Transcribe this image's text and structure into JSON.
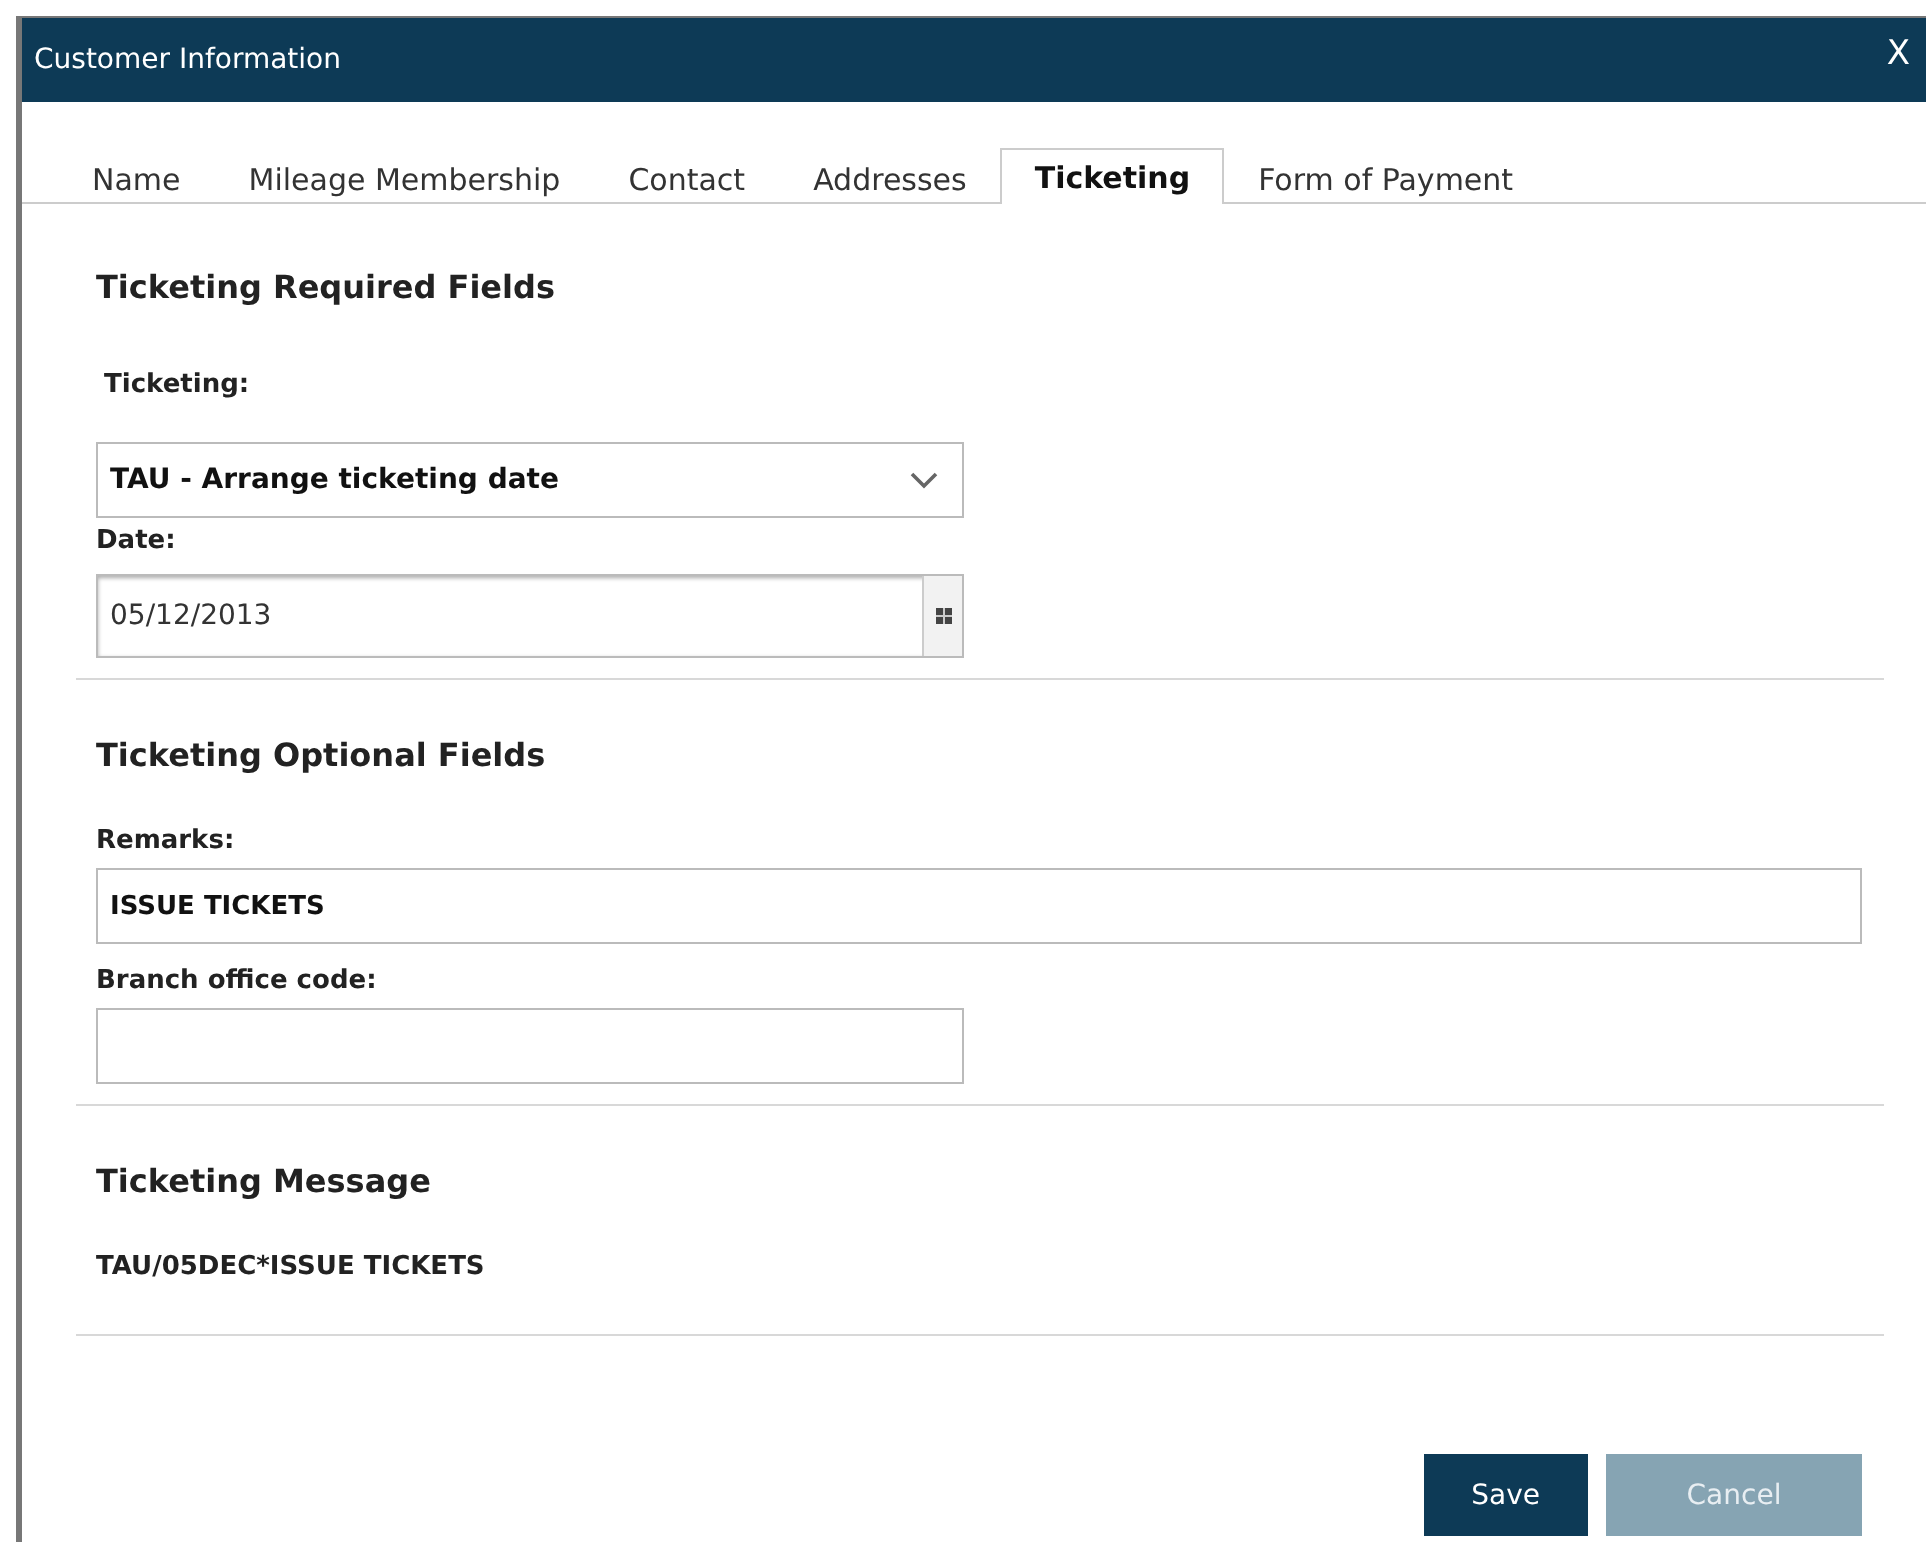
{
  "window": {
    "title": "Customer Information",
    "close": "X"
  },
  "tabs": [
    {
      "label": "Name",
      "selected": false
    },
    {
      "label": "Mileage Membership",
      "selected": false
    },
    {
      "label": "Contact",
      "selected": false
    },
    {
      "label": "Addresses",
      "selected": false
    },
    {
      "label": "Ticketing",
      "selected": true
    },
    {
      "label": "Form of Payment",
      "selected": false
    }
  ],
  "sections": [
    {
      "heading": "Ticketing Required Fields",
      "fields": [
        {
          "kind": "dropdown",
          "label": "Ticketing:",
          "value": "TAU - Arrange ticketing date"
        },
        {
          "kind": "date",
          "label": "Date:",
          "value": "05/12/2013"
        }
      ]
    },
    {
      "heading": "Ticketing Optional Fields",
      "fields": [
        {
          "kind": "remark",
          "label": "Remarks:",
          "value": "ISSUE TICKETS"
        },
        {
          "kind": "text",
          "label": "Branch office code:"
        }
      ]
    },
    {
      "heading": "Ticketing Message",
      "message": "TAU/05DEC*ISSUE TICKETS"
    }
  ],
  "buttons": [
    {
      "label": "Save",
      "disabled": false
    },
    {
      "label": "Cancel",
      "disabled": true
    }
  ]
}
